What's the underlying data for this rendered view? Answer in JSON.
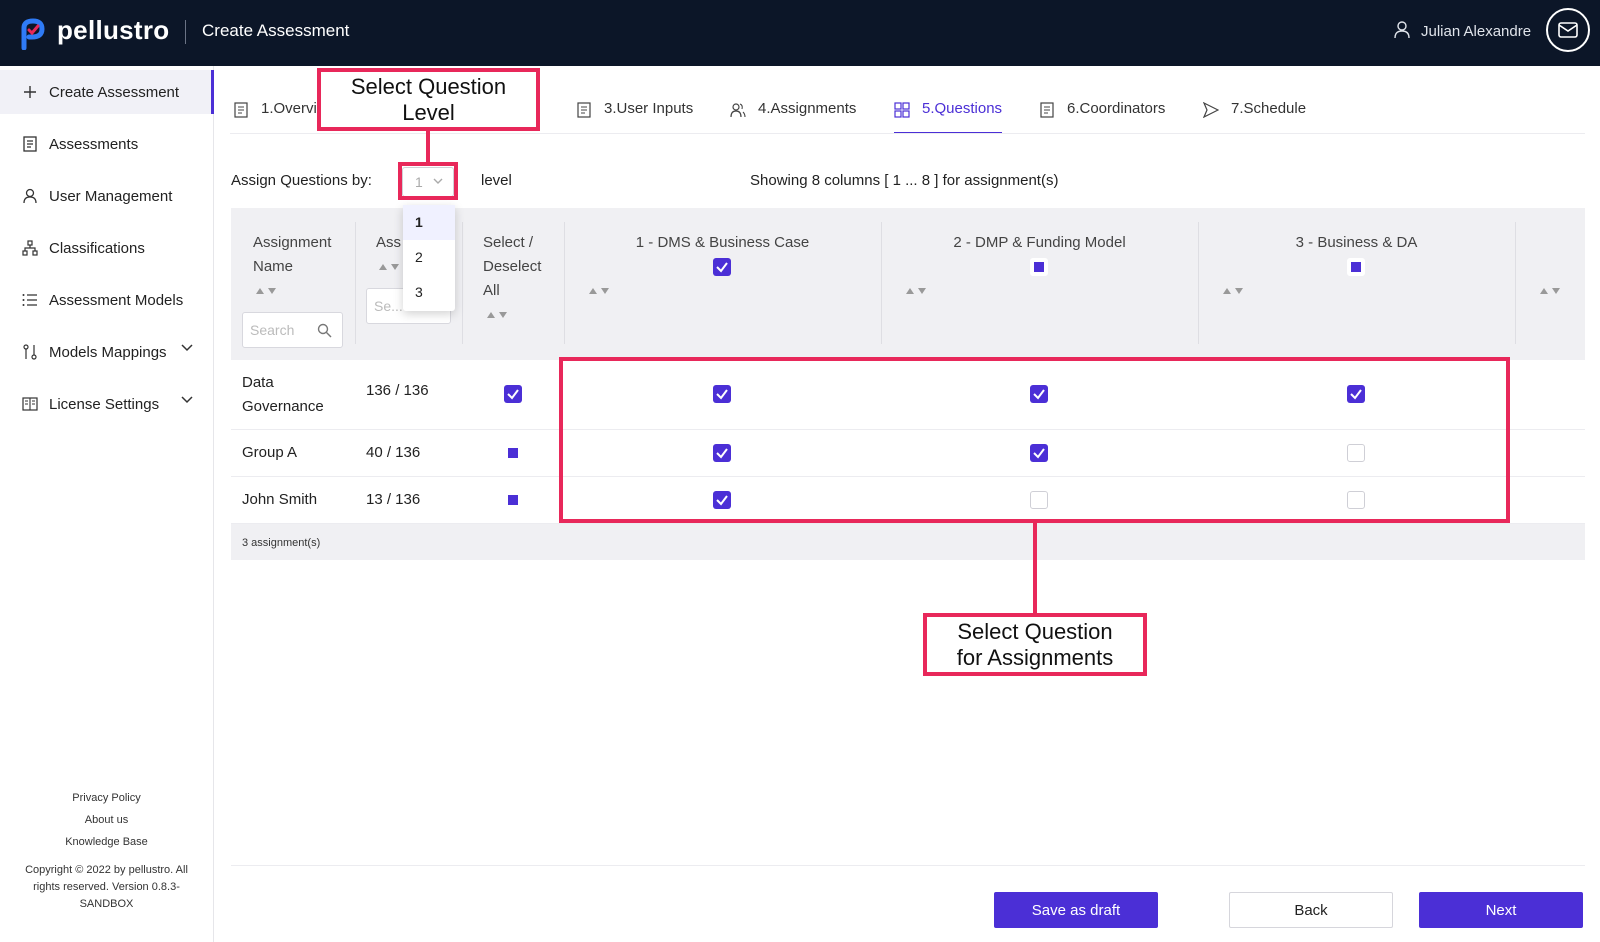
{
  "header": {
    "brand": "pellustro",
    "page_title": "Create Assessment",
    "user_name": "Julian Alexandre"
  },
  "sidebar": {
    "items": [
      {
        "label": "Create Assessment",
        "icon": "plus-icon"
      },
      {
        "label": "Assessments",
        "icon": "document-icon"
      },
      {
        "label": "User Management",
        "icon": "user-icon"
      },
      {
        "label": "Classifications",
        "icon": "hierarchy-icon"
      },
      {
        "label": "Assessment Models",
        "icon": "list-icon"
      },
      {
        "label": "Models Mappings",
        "icon": "mapping-icon"
      },
      {
        "label": "License Settings",
        "icon": "license-icon"
      }
    ],
    "footer_links": [
      "Privacy Policy",
      "About us",
      "Knowledge Base"
    ],
    "copyright_lines": [
      "Copyright © 2022 by pellustro. All",
      "rights reserved. Version 0.8.3-",
      "SANDBOX"
    ]
  },
  "tabs": [
    {
      "label": "1.Overvi"
    },
    {
      "label": "3.User Inputs"
    },
    {
      "label": "4.Assignments"
    },
    {
      "label": "5.Questions"
    },
    {
      "label": "6.Coordinators"
    },
    {
      "label": "7.Schedule"
    }
  ],
  "assign": {
    "label": "Assign Questions by:",
    "selected_level": "1",
    "level_word": "level",
    "showing": "Showing 8 columns [ 1 ... 8 ] for assignment(s)",
    "options": [
      "1",
      "2",
      "3"
    ]
  },
  "table": {
    "headers": {
      "assignment_name_1": "Assignment",
      "assignment_name_2": "Name",
      "assigned": "Ass",
      "select_1": "Select /",
      "select_2": "Deselect",
      "select_3": "All",
      "col1": "1 - DMS & Business Case",
      "col2": "2 - DMP & Funding Model",
      "col3": "3 - Business & DA"
    },
    "search_placeholder": "Search",
    "search_placeholder_short": "Se...",
    "rows": [
      {
        "name_1": "Data",
        "name_2": "Governance",
        "count": "136 / 136",
        "select": "checked",
        "c1": "checked",
        "c2": "checked",
        "c3": "checked"
      },
      {
        "name_1": "Group A",
        "name_2": "",
        "count": "40 / 136",
        "select": "partial",
        "c1": "checked",
        "c2": "checked",
        "c3": "empty"
      },
      {
        "name_1": "John Smith",
        "name_2": "",
        "count": "13 / 136",
        "select": "partial",
        "c1": "checked",
        "c2": "empty",
        "c3": "empty"
      }
    ],
    "footer": "3 assignment(s)",
    "header_checks": {
      "col1": "checked",
      "col2": "partial",
      "col3": "partial"
    }
  },
  "annotations": {
    "level_1": "Select Question",
    "level_2": "Level",
    "assign_1": "Select Question",
    "assign_2": "for Assignments"
  },
  "buttons": {
    "save_draft": "Save as draft",
    "back": "Back",
    "next": "Next"
  },
  "colors": {
    "accent": "#4b2fd6",
    "topbar": "#0c1628",
    "annotation": "#e8285a"
  }
}
